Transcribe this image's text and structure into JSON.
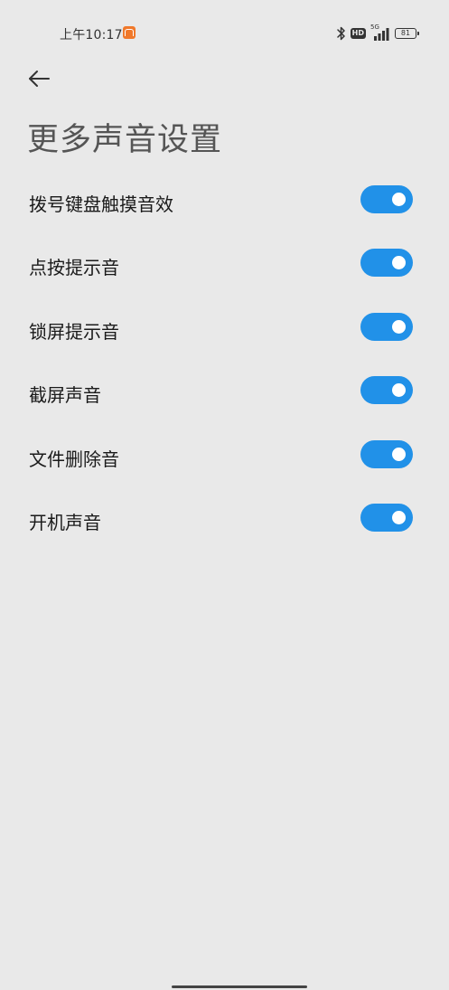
{
  "status_bar": {
    "time": "上午10:17",
    "network": "5G",
    "battery": "81"
  },
  "header": {
    "title": "更多声音设置"
  },
  "settings": [
    {
      "label": "拨号键盘触摸音效",
      "enabled": true
    },
    {
      "label": "点按提示音",
      "enabled": true
    },
    {
      "label": "锁屏提示音",
      "enabled": true
    },
    {
      "label": "截屏声音",
      "enabled": true
    },
    {
      "label": "文件删除音",
      "enabled": true
    },
    {
      "label": "开机声音",
      "enabled": true
    }
  ],
  "colors": {
    "background": "#e9e9e9",
    "toggle_on": "#2191e8",
    "badge": "#f0782a"
  }
}
